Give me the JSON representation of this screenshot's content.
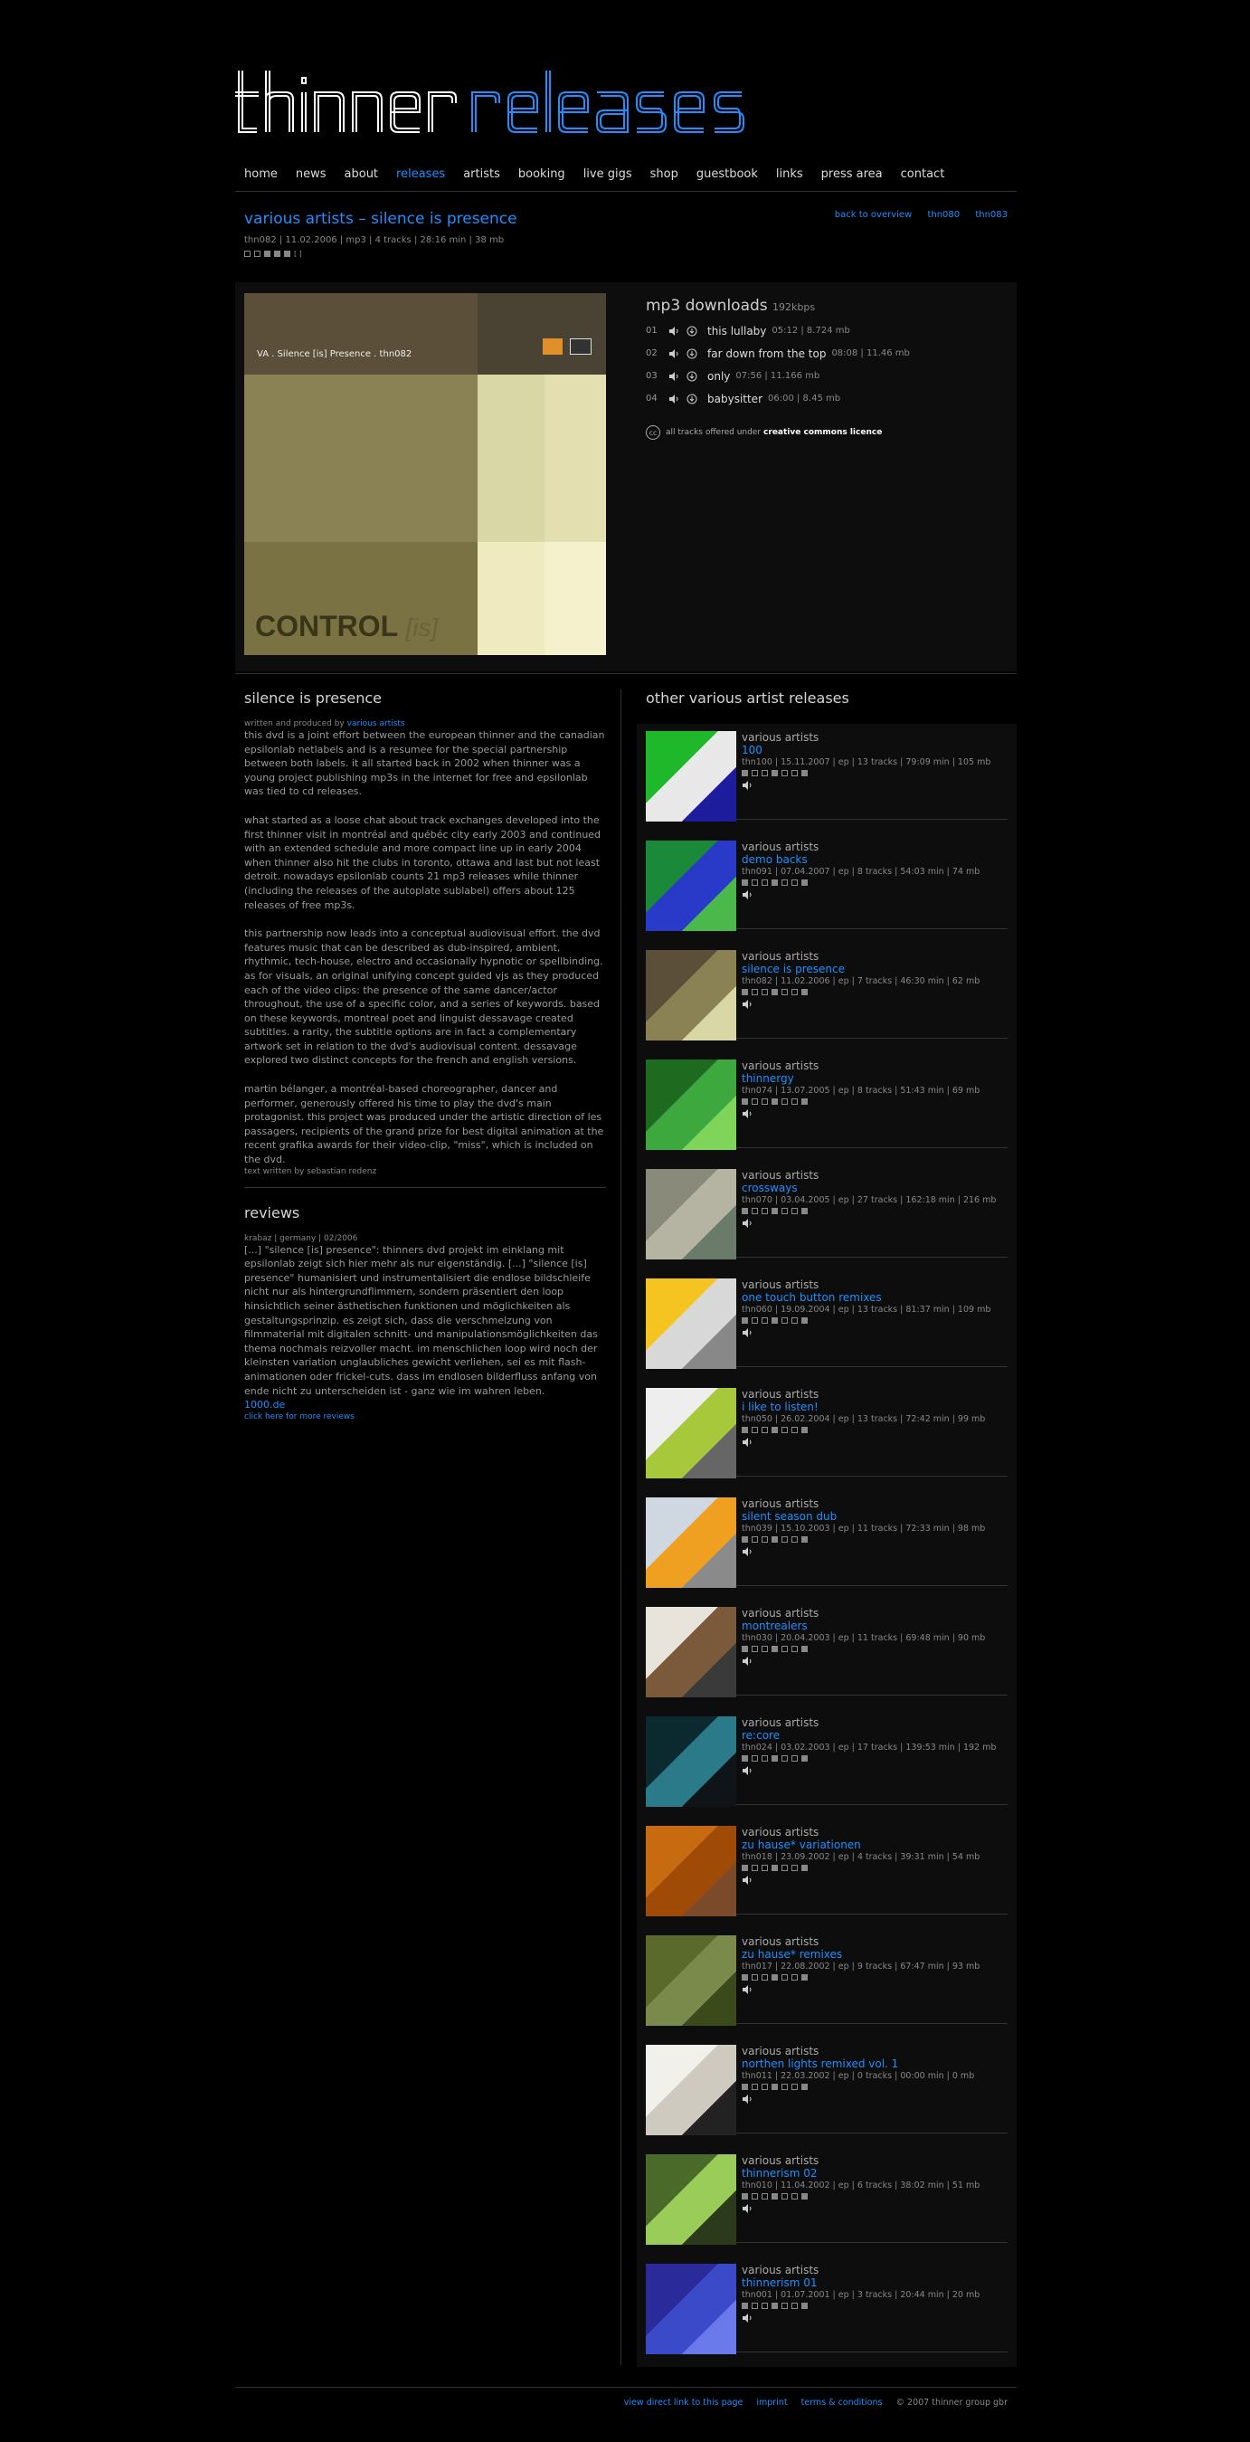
{
  "nav": [
    "home",
    "news",
    "about",
    "releases",
    "artists",
    "booking",
    "live gigs",
    "shop",
    "guestbook",
    "links",
    "press area",
    "contact"
  ],
  "nav_active_index": 3,
  "release": {
    "title": "various artists – silence is presence",
    "meta": "thn082 | 11.02.2006 | mp3 | 4 tracks | 28:16 min | 38 mb",
    "links": {
      "back": "back to overview",
      "prev": "thn080",
      "next": "thn083"
    }
  },
  "cover": {
    "label": "VA . Silence [is] Presence . thn082",
    "big_text": "CONTROL",
    "big_text_italic": "[is]"
  },
  "downloads": {
    "title": "mp3 downloads",
    "bitrate": "192kbps",
    "tracks": [
      {
        "num": "01",
        "name": "this lullaby",
        "meta": "05:12 | 8.724 mb"
      },
      {
        "num": "02",
        "name": "far down from the top",
        "meta": "08:08 | 11.46 mb"
      },
      {
        "num": "03",
        "name": "only",
        "meta": "07:56 | 11.166 mb"
      },
      {
        "num": "04",
        "name": "babysitter",
        "meta": "06:00 | 8.45 mb"
      }
    ],
    "cc_text": "all tracks offered under",
    "cc_link": "creative commons licence",
    "cc_icon": "cc"
  },
  "about": {
    "title": "silence is presence",
    "credit_prefix": "written and produced by",
    "credit_link": "various artists",
    "p1": "this dvd is a joint effort between the european thinner and the canadian epsilonlab netlabels and is a resumee for the special partnership between both labels. it all started back in 2002 when thinner was a young project publishing mp3s in the internet for free and epsilonlab was tied to cd releases.",
    "p2": "what started as a loose chat about track exchanges developed into the first thinner visit in montréal and québéc city early 2003 and continued with an extended schedule and more compact line up in early 2004 when thinner also hit the clubs in toronto, ottawa and last but not least detroit. nowadays epsilonlab counts 21 mp3 releases while thinner (including the releases of the autoplate sublabel) offers about 125 releases of free mp3s.",
    "p3": "this partnership now leads into a conceptual audiovisual effort. the dvd features music that can be described as dub-inspired, ambient, rhythmic, tech-house, electro and occasionally hypnotic or spellbinding. as for visuals, an original unifying concept guided vjs as they produced each of the video clips: the presence of the same dancer/actor throughout, the use of a specific color, and a series of keywords. based on these keywords, montreal poet and linguist dessavage created subtitles. a rarity, the subtitle options are in fact a complementary artwork set in relation to the dvd's audiovisual content. dessavage explored two distinct concepts for the french and english versions.",
    "p4": "martin bélanger, a montréal-based choreographer, dancer and performer, generously offered his time to play the dvd's main protagonist. this project was produced under the artistic direction of les passagers, recipients of the grand prize for best digital animation at the recent grafika awards for their video-clip, \"miss\", which is included on the dvd.",
    "text_by": "text written by sebastian redenz"
  },
  "reviews": {
    "title": "reviews",
    "source": "krabaz | germany | 02/2006",
    "text": "[...] \"silence [is] presence\": thinners dvd projekt im einklang mit epsilonlab zeigt sich hier mehr als nur eigenständig. [...] \"silence [is] presence\" humanisiert und instrumentalisiert die endlose bildschleife nicht nur als hintergrundflimmern, sondern präsentiert den loop hinsichtlich seiner ästhetischen funktionen und möglichkeiten als gestaltungsprinzip. es zeigt sich, dass die verschmelzung von filmmaterial mit digitalen schnitt- und manipulationsmöglichkeiten das thema nochmals reizvoller macht. im menschlichen loop wird noch der kleinsten variation unglaubliches gewicht verliehen, sei es mit flash-animationen oder frickel-cuts. dass im endlosen bilderfluss anfang von ende nicht zu unterscheiden ist - ganz wie im wahren leben.",
    "link1": "1000.de",
    "link2": "click here for more reviews"
  },
  "other": {
    "title": "other various artist releases",
    "items": [
      {
        "artist": "various artists",
        "title": "100",
        "meta": "thn100 | 15.11.2007 | ep | 13 tracks | 79:09 min | 105 mb",
        "colors": [
          "#1fb82a",
          "#e8e8e8",
          "#1c1c9c"
        ]
      },
      {
        "artist": "various artists",
        "title": "demo backs",
        "meta": "thn091 | 07.04.2007 | ep | 8 tracks | 54:03 min | 74 mb",
        "colors": [
          "#1a8a3a",
          "#2a3ac8",
          "#4ab84a"
        ]
      },
      {
        "artist": "various artists",
        "title": "silence is presence",
        "meta": "thn082 | 11.02.2006 | ep | 7 tracks | 46:30 min | 62 mb",
        "colors": [
          "#5c4f3a",
          "#8a8255",
          "#dad7a6"
        ]
      },
      {
        "artist": "various artists",
        "title": "thinnergy",
        "meta": "thn074 | 13.07.2005 | ep | 8 tracks | 51:43 min | 69 mb",
        "colors": [
          "#1e6a1e",
          "#3da83d",
          "#7fd45a"
        ]
      },
      {
        "artist": "various artists",
        "title": "crossways",
        "meta": "thn070 | 03.04.2005 | ep | 27 tracks | 162:18 min | 216 mb",
        "colors": [
          "#8a8a7a",
          "#b5b4a2",
          "#6a7b6a"
        ]
      },
      {
        "artist": "various artists",
        "title": "one touch button remixes",
        "meta": "thn060 | 19.09.2004 | ep | 13 tracks | 81:37 min | 109 mb",
        "colors": [
          "#f5c421",
          "#d8d8d8",
          "#888888"
        ]
      },
      {
        "artist": "various artists",
        "title": "i like to listen!",
        "meta": "thn050 | 26.02.2004 | ep | 13 tracks | 72:42 min | 99 mb",
        "colors": [
          "#eeeeee",
          "#a6c83a",
          "#666666"
        ]
      },
      {
        "artist": "various artists",
        "title": "silent season dub",
        "meta": "thn039 | 15.10.2003 | ep | 11 tracks | 72:33 min | 98 mb",
        "colors": [
          "#cfd8e0",
          "#f0a020",
          "#8a8a8a"
        ]
      },
      {
        "artist": "various artists",
        "title": "montrealers",
        "meta": "thn030 | 20.04.2003 | ep | 11 tracks | 69:48 min | 90 mb",
        "colors": [
          "#e8e4dc",
          "#7a5a3a",
          "#3a3a3a"
        ]
      },
      {
        "artist": "various artists",
        "title": "re:core",
        "meta": "thn024 | 03.02.2003 | ep | 17 tracks | 139:53 min | 192 mb",
        "colors": [
          "#0a2a30",
          "#2a7a8a",
          "#0e1418"
        ]
      },
      {
        "artist": "various artists",
        "title": "zu hause* variationen",
        "meta": "thn018 | 23.09.2002 | ep | 4 tracks | 39:31 min | 54 mb",
        "colors": [
          "#c86a10",
          "#a04a08",
          "#7a4a2a"
        ]
      },
      {
        "artist": "various artists",
        "title": "zu hause* remixes",
        "meta": "thn017 | 22.08.2002 | ep | 9 tracks | 67:47 min | 93 mb",
        "colors": [
          "#5a6a2a",
          "#7a8a4a",
          "#3a4a1a"
        ]
      },
      {
        "artist": "various artists",
        "title": "northen lights remixed vol. 1",
        "meta": "thn011 | 22.03.2002 | ep | 0 tracks | 00:00 min | 0 mb",
        "colors": [
          "#f2f0ea",
          "#cfcac0",
          "#222222"
        ]
      },
      {
        "artist": "various artists",
        "title": "thinnerism 02",
        "meta": "thn010 | 11.04.2002 | ep | 6 tracks | 38:02 min | 51 mb",
        "colors": [
          "#4a6a2a",
          "#9acc5a",
          "#2a3a1a"
        ]
      },
      {
        "artist": "various artists",
        "title": "thinnerism 01",
        "meta": "thn001 | 01.07.2001 | ep | 3 tracks | 20:44 min | 20 mb",
        "colors": [
          "#2a2a9a",
          "#3a4ac8",
          "#6a7aea"
        ]
      }
    ]
  },
  "footer": {
    "direct_link": "view direct link to this page",
    "imprint": "imprint",
    "terms": "terms & conditions",
    "copyright": "© 2007 thinner group gbr"
  },
  "colors": {
    "accent": "#1f8fff",
    "bg": "#000000",
    "panel": "#0d0d0d",
    "text": "#9a9a9a",
    "divider": "#333333"
  }
}
